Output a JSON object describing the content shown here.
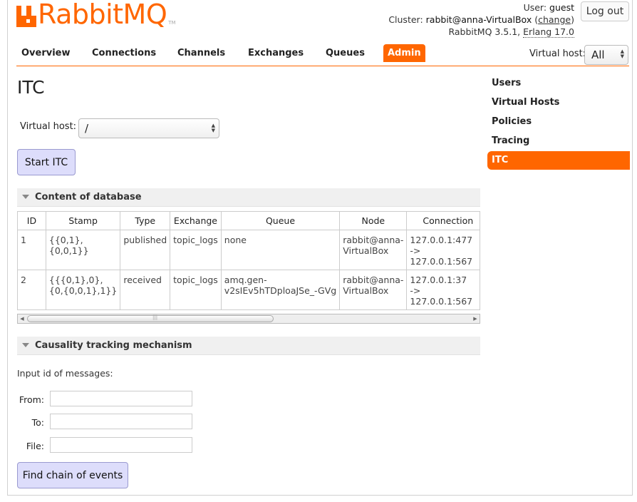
{
  "brand": {
    "name": "RabbitMQ",
    "tm": "TM",
    "color": "#ff6600"
  },
  "header": {
    "user_label": "User:",
    "user_name": "guest",
    "cluster_label": "Cluster:",
    "cluster_name": "rabbit@anna-VirtualBox",
    "change_link": "change",
    "version": "RabbitMQ 3.5.1,",
    "erlang": "Erlang 17.0",
    "logout": "Log out"
  },
  "nav": {
    "tabs": [
      "Overview",
      "Connections",
      "Channels",
      "Exchanges",
      "Queues",
      "Admin"
    ],
    "active_tab": "Admin",
    "vhost_label": "Virtual host:",
    "vhost_value": "All"
  },
  "sidebar": {
    "items": [
      "Users",
      "Virtual Hosts",
      "Policies",
      "Tracing",
      "ITC"
    ],
    "active": "ITC"
  },
  "main": {
    "title": "ITC",
    "vhost_label": "Virtual host:",
    "vhost_value": "/",
    "start_button": "Start ITC"
  },
  "content_section": {
    "title": "Content of database",
    "columns": [
      "ID",
      "Stamp",
      "Type",
      "Exchange",
      "Queue",
      "Node",
      "Connection"
    ],
    "rows": [
      {
        "id": "1",
        "stamp_1": "{{0,1},",
        "stamp_2": "{0,0,1}}",
        "type": "published",
        "exchange": "topic_logs",
        "queue_1": "none",
        "queue_2": "",
        "node_1": "rabbit@anna-",
        "node_2": "VirtualBox",
        "conn_1": "127.0.0.1:477",
        "conn_2": "->",
        "conn_3": "127.0.0.1:567"
      },
      {
        "id": "2",
        "stamp_1": "{{{0,1},0},",
        "stamp_2": "{0,{0,0,1},1}}",
        "type": "received",
        "exchange": "topic_logs",
        "queue_1": "amq.gen-",
        "queue_2": "v2sIEv5hTDploaJSe_-GVg",
        "node_1": "rabbit@anna-",
        "node_2": "VirtualBox",
        "conn_1": "127.0.0.1:37",
        "conn_2": "->",
        "conn_3": "127.0.0.1:567"
      }
    ]
  },
  "causality_section": {
    "title": "Causality tracking mechanism",
    "instruction": "Input id of messages:",
    "from_label": "From:",
    "to_label": "To:",
    "file_label": "File:",
    "from_value": "",
    "to_value": "",
    "file_value": "",
    "find_button": "Find chain of events"
  }
}
